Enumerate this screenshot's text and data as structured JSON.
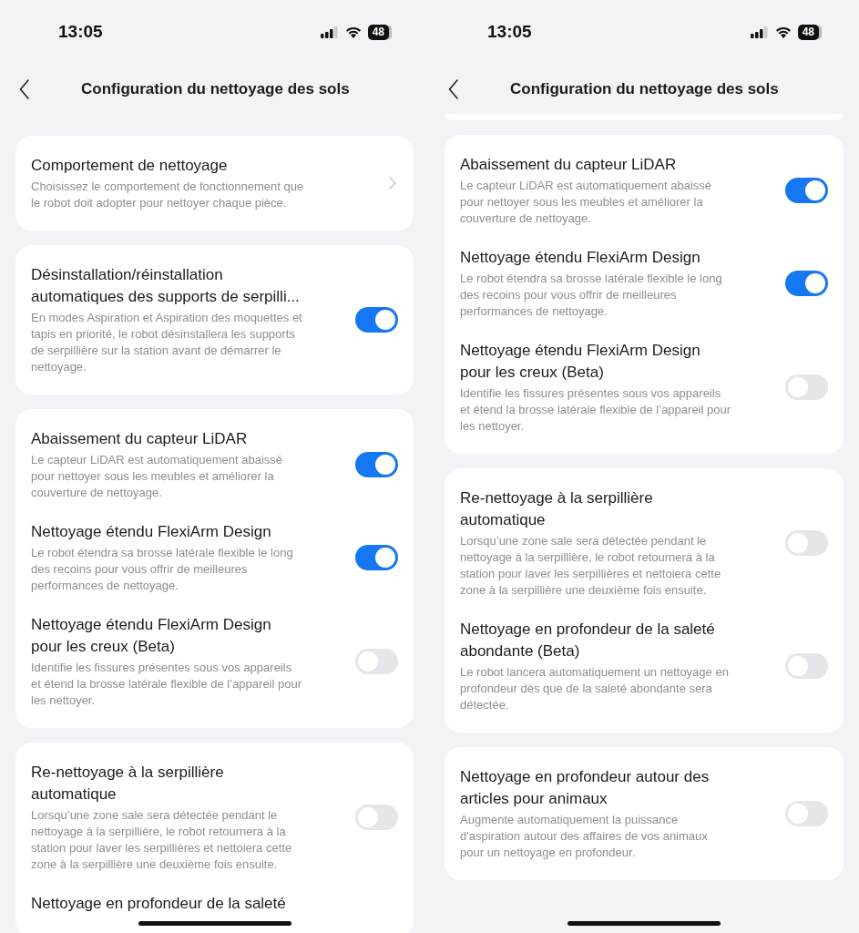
{
  "screens": [
    {
      "time": "13:05",
      "battery": "48",
      "title": "Configuration du nettoyage des sols",
      "scrolled_card_edge": false,
      "groups": [
        {
          "items": [
            {
              "kind": "link",
              "title": "Comportement de nettoyage",
              "description": "Choisissez le comportement de fonctionnement que le robot doit adopter pour nettoyer chaque pièce."
            }
          ]
        },
        {
          "items": [
            {
              "kind": "toggle",
              "title": "Désinstallation/réinstallation automatiques des supports de serpilli...",
              "description": "En modes Aspiration et Aspiration des moquettes et tapis en priorité, le robot désinstallera les supports de serpillière sur la station avant de démarrer le nettoyage.",
              "on": true
            }
          ]
        },
        {
          "items": [
            {
              "kind": "toggle",
              "title": "Abaissement du capteur LiDAR",
              "description": "Le capteur LiDAR est automatiquement abaissé pour nettoyer sous les meubles et améliorer la couverture de nettoyage.",
              "on": true
            },
            {
              "kind": "toggle",
              "title": "Nettoyage étendu FlexiArm Design",
              "description": "Le robot étendra sa brosse latérale flexible le long des recoins pour vous offrir de meilleures performances de nettoyage.",
              "on": true
            },
            {
              "kind": "toggle",
              "title": "Nettoyage étendu FlexiArm Design pour les creux (Beta)",
              "description": "Identifie les fissures présentes sous vos appareils et étend la brosse latérale flexible de l’appareil pour les nettoyer.",
              "on": false
            }
          ]
        },
        {
          "items": [
            {
              "kind": "toggle",
              "title": "Re-nettoyage à la serpillière automatique",
              "description": "Lorsqu’une zone sale sera détectée pendant le nettoyage à la serpillière, le robot retournera à la station pour laver les serpillières et nettoiera cette zone à la serpillière une deuxième fois ensuite.",
              "on": false
            },
            {
              "kind": "title_only",
              "title": "Nettoyage en profondeur de la saleté"
            }
          ]
        }
      ]
    },
    {
      "time": "13:05",
      "battery": "48",
      "title": "Configuration du nettoyage des sols",
      "scrolled_card_edge": true,
      "groups": [
        {
          "items": [
            {
              "kind": "toggle",
              "title": "Abaissement du capteur LiDAR",
              "description": "Le capteur LiDAR est automatiquement abaissé pour nettoyer sous les meubles et améliorer la couverture de nettoyage.",
              "on": true
            },
            {
              "kind": "toggle",
              "title": "Nettoyage étendu FlexiArm Design",
              "description": "Le robot étendra sa brosse latérale flexible le long des recoins pour vous offrir de meilleures performances de nettoyage.",
              "on": true
            },
            {
              "kind": "toggle",
              "title": "Nettoyage étendu FlexiArm Design pour les creux (Beta)",
              "description": "Identifie les fissures présentes sous vos appareils et étend la brosse latérale flexible de l’appareil pour les nettoyer.",
              "on": false
            }
          ]
        },
        {
          "items": [
            {
              "kind": "toggle",
              "title": "Re-nettoyage à la serpillière automatique",
              "description": "Lorsqu’une zone sale sera détectée pendant le nettoyage à la serpillière, le robot retournera à la station pour laver les serpillières et nettoiera cette zone à la serpillière une deuxième fois ensuite.",
              "on": false
            },
            {
              "kind": "toggle",
              "title": "Nettoyage en profondeur de la saleté abondante (Beta)",
              "description": "Le robot lancera automatiquement un nettoyage en profondeur dès que de la saleté abondante sera détectée.",
              "on": false
            }
          ]
        },
        {
          "items": [
            {
              "kind": "toggle",
              "title": "Nettoyage en profondeur autour des articles pour animaux",
              "description": "Augmente automatiquement la puissance d'aspiration autour des affaires de vos animaux pour un nettoyage en profondeur.",
              "on": false
            }
          ]
        }
      ]
    }
  ]
}
